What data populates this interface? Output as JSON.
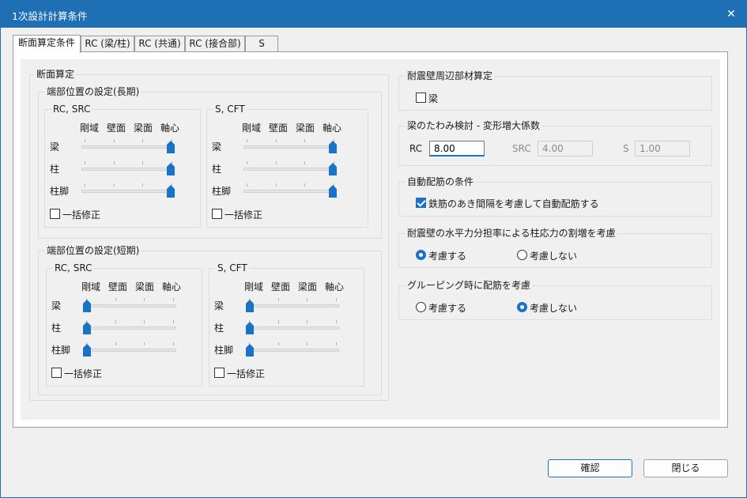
{
  "window": {
    "title": "1次設計計算条件"
  },
  "tabs": [
    "断面算定条件",
    "RC (梁/柱)",
    "RC (共通)",
    "RC (接合部)",
    "S"
  ],
  "main": {
    "section_title": "断面算定",
    "long_term": {
      "title": "端部位置の設定(長期)",
      "rc": {
        "title": "RC, SRC",
        "columns": [
          "剛域",
          "壁面",
          "梁面",
          "軸心"
        ],
        "rows": [
          "梁",
          "柱",
          "柱脚"
        ],
        "values": [
          3,
          3,
          3
        ],
        "bulk_label": "一括修正"
      },
      "s": {
        "title": "S, CFT",
        "columns": [
          "剛域",
          "壁面",
          "梁面",
          "軸心"
        ],
        "rows": [
          "梁",
          "柱",
          "柱脚"
        ],
        "values": [
          3,
          3,
          3
        ],
        "bulk_label": "一括修正"
      }
    },
    "short_term": {
      "title": "端部位置の設定(短期)",
      "rc": {
        "title": "RC, SRC",
        "columns": [
          "剛域",
          "壁面",
          "梁面",
          "軸心"
        ],
        "rows": [
          "梁",
          "柱",
          "柱脚"
        ],
        "values": [
          0,
          0,
          0
        ],
        "bulk_label": "一括修正"
      },
      "s": {
        "title": "S, CFT",
        "columns": [
          "剛域",
          "壁面",
          "梁面",
          "軸心"
        ],
        "rows": [
          "梁",
          "柱",
          "柱脚"
        ],
        "values": [
          0,
          0,
          0
        ],
        "bulk_label": "一括修正"
      }
    }
  },
  "right": {
    "seismic_wall": {
      "title": "耐震壁周辺部材算定",
      "beam_label": "梁",
      "beam_checked": false
    },
    "deflection": {
      "title": "梁のたわみ検討 - 変形増大係数",
      "rc_label": "RC",
      "rc_value": "8.00",
      "src_label": "SRC",
      "src_value": "4.00",
      "s_label": "S",
      "s_value": "1.00"
    },
    "auto_rebar": {
      "title": "自動配筋の条件",
      "option_label": "鉄筋のあき間隔を考慮して自動配筋する",
      "option_checked": true
    },
    "horizontal_force": {
      "title": "耐震壁の水平力分担率による柱応力の割増を考慮",
      "yes_label": "考慮する",
      "no_label": "考慮しない",
      "selected": "yes"
    },
    "grouping": {
      "title": "グルーピング時に配筋を考慮",
      "yes_label": "考慮する",
      "no_label": "考慮しない",
      "selected": "no"
    }
  },
  "footer": {
    "ok_label": "確認",
    "close_label": "閉じる"
  },
  "colors": {
    "accent": "#1a73c7",
    "titlebar": "#1f6fb4"
  }
}
